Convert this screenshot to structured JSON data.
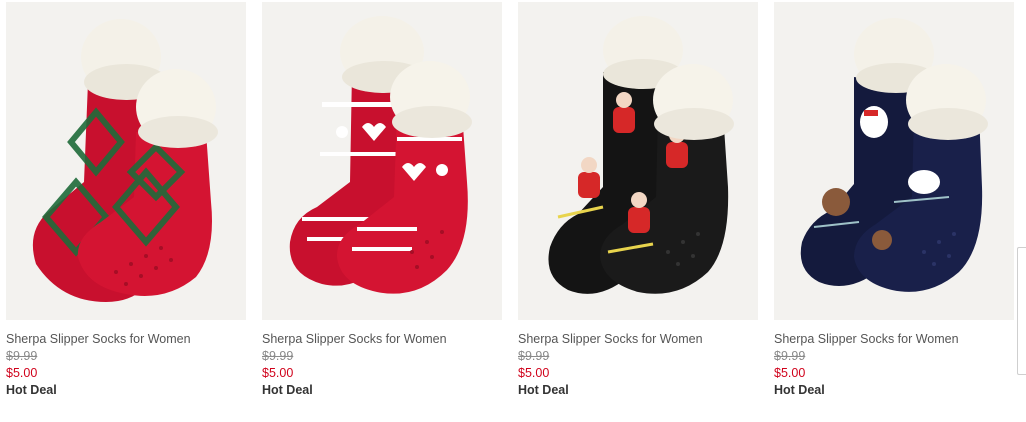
{
  "products": [
    {
      "name": "Sherpa Slipper Socks for Women",
      "original_price": "$9.99",
      "sale_price": "$5.00",
      "badge": "Hot Deal",
      "sock_color": "#c8102e",
      "pattern": "argyle",
      "pattern_color": "#1f6b3a"
    },
    {
      "name": "Sherpa Slipper Socks for Women",
      "original_price": "$9.99",
      "sale_price": "$5.00",
      "badge": "Hot Deal",
      "sock_color": "#c8102e",
      "pattern": "fair-isle",
      "pattern_color": "#ffffff"
    },
    {
      "name": "Sherpa Slipper Socks for Women",
      "original_price": "$9.99",
      "sale_price": "$5.00",
      "badge": "Hot Deal",
      "sock_color": "#141414",
      "pattern": "santa-skiers",
      "pattern_color": "#d62828"
    },
    {
      "name": "Sherpa Slipper Socks for Women",
      "original_price": "$9.99",
      "sale_price": "$5.00",
      "badge": "Hot Deal",
      "sock_color": "#141a3d",
      "pattern": "bears-skating",
      "pattern_color": "#ffffff"
    }
  ],
  "colors": {
    "sale": "#d0021b",
    "muted_text": "#555555",
    "image_bg": "#f3f2ef",
    "sherpa": "#f4f1e8"
  }
}
